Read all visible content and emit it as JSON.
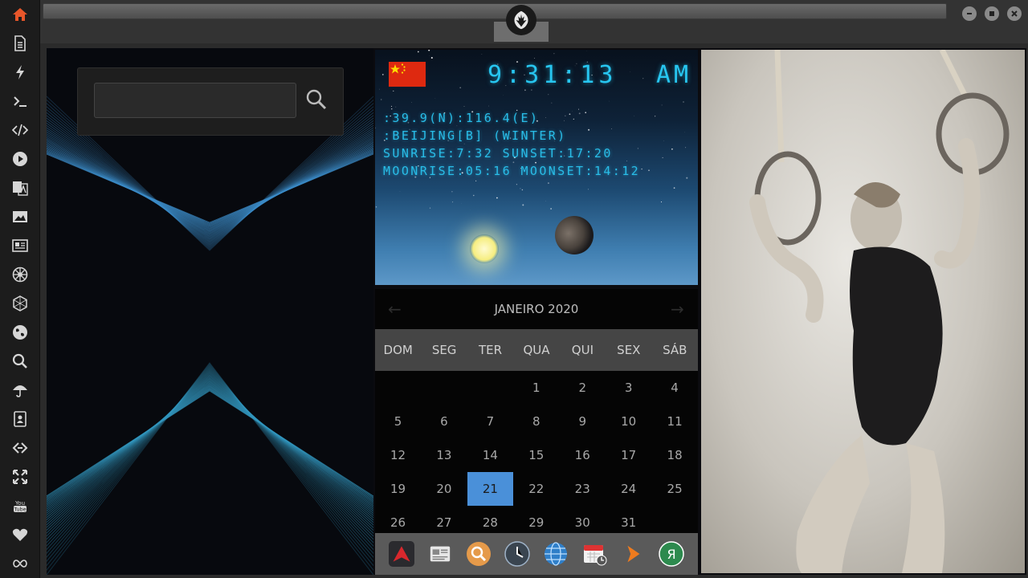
{
  "sidebar": {
    "items": [
      {
        "name": "home-icon",
        "color": "#e8562a"
      },
      {
        "name": "document-icon",
        "color": "#d6d6d6"
      },
      {
        "name": "lightning-icon",
        "color": "#d6d6d6"
      },
      {
        "name": "terminal-icon",
        "color": "#d6d6d6"
      },
      {
        "name": "code-icon",
        "color": "#d6d6d6"
      },
      {
        "name": "play-icon",
        "color": "#d6d6d6"
      },
      {
        "name": "translate-icon",
        "color": "#d6d6d6"
      },
      {
        "name": "image-icon",
        "color": "#d6d6d6"
      },
      {
        "name": "news-icon",
        "color": "#d6d6d6"
      },
      {
        "name": "imperial-icon",
        "color": "#d6d6d6"
      },
      {
        "name": "hexagon-icon",
        "color": "#d6d6d6"
      },
      {
        "name": "globe-icon",
        "color": "#d6d6d6"
      },
      {
        "name": "search-icon",
        "color": "#d6d6d6"
      },
      {
        "name": "umbrella-icon",
        "color": "#d6d6d6"
      },
      {
        "name": "contacts-icon",
        "color": "#d6d6d6"
      },
      {
        "name": "link-icon",
        "color": "#d6d6d6"
      },
      {
        "name": "expand-icon",
        "color": "#d6d6d6"
      },
      {
        "name": "youtube-icon",
        "color": "#d6d6d6"
      },
      {
        "name": "heart-icon",
        "color": "#d6d6d6"
      },
      {
        "name": "infinity-icon",
        "color": "#d6d6d6"
      }
    ]
  },
  "topbar": {
    "emblem": "rebel-alliance-icon"
  },
  "search": {
    "value": "",
    "placeholder": ""
  },
  "clock": {
    "time": "9:31:13",
    "ampm": "AM",
    "coords": ":39.9(N):116.4(E)",
    "location": ":BEIJING[B] (WINTER)",
    "sun": "SUNRISE:7:32 SUNSET:17:20",
    "moon": "MOONRISE:05:16 MOONSET:14:12"
  },
  "calendar": {
    "prev": "←",
    "next": "→",
    "month_label": "JANEIRO 2020",
    "weekdays": [
      "DOM",
      "SEG",
      "TER",
      "QUA",
      "QUI",
      "SEX",
      "SÁB"
    ],
    "first_weekday": 3,
    "days_in_month": 31,
    "today": 21,
    "accent": "#4a90d9"
  },
  "dock": {
    "items": [
      "app-launcher-icon",
      "news-reader-icon",
      "search-icon",
      "clock-icon",
      "browser-globe-icon",
      "calendar-icon",
      "arrow-icon",
      "yandex-icon"
    ]
  }
}
